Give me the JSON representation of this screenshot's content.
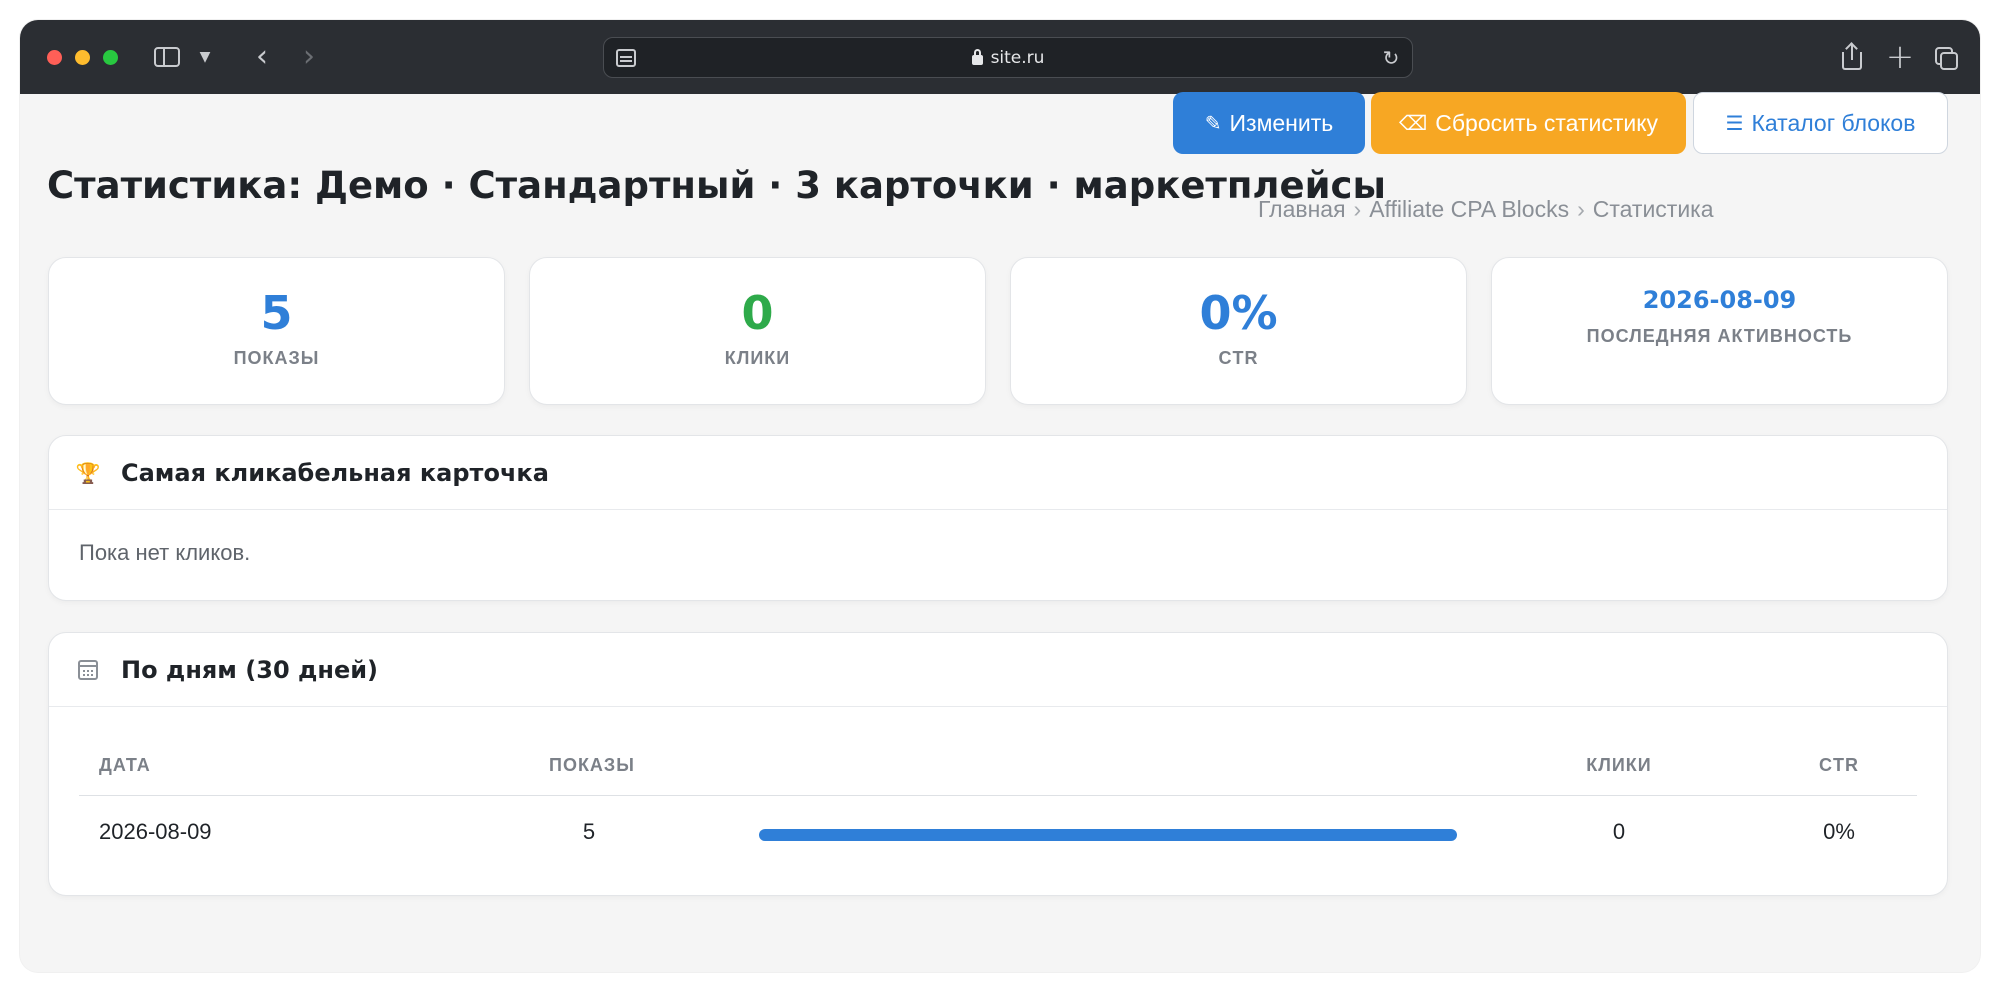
{
  "browser": {
    "url": "site.ru"
  },
  "toolbar": {
    "edit_label": "Изменить",
    "reset_label": "Сбросить статистику",
    "catalog_label": "Каталог блоков"
  },
  "header": {
    "title": "Статистика: Демо · Стандартный · 3 карточки · маркетплейсы",
    "breadcrumb": [
      "Главная",
      "Affiliate CPA Blocks",
      "Статистика"
    ]
  },
  "stats": [
    {
      "value": "5",
      "label": "ПОКАЗЫ",
      "color": "#2f7fd8"
    },
    {
      "value": "0",
      "label": "КЛИКИ",
      "color": "#2eaa4a"
    },
    {
      "value": "0%",
      "label": "CTR",
      "color": "#2f7fd8"
    },
    {
      "value": "2026-08-09",
      "label": "ПОСЛЕДНЯЯ АКТИВНОСТЬ",
      "color": "#2f7fd8"
    }
  ],
  "top_card": {
    "title": "Самая кликабельная карточка",
    "empty_text": "Пока нет кликов."
  },
  "days": {
    "title": "По дням (30 дней)",
    "columns": [
      "ДАТА",
      "ПОКАЗЫ",
      "КЛИКИ",
      "CTR"
    ],
    "rows": [
      {
        "date": "2026-08-09",
        "views": "5",
        "views_share": 1.0,
        "clicks": "0",
        "ctr": "0%"
      }
    ]
  },
  "icons": {
    "edit": "pencil-icon",
    "reset": "eraser-icon",
    "catalog": "list-icon",
    "top_card": "trophy-icon",
    "days": "calendar-icon"
  }
}
